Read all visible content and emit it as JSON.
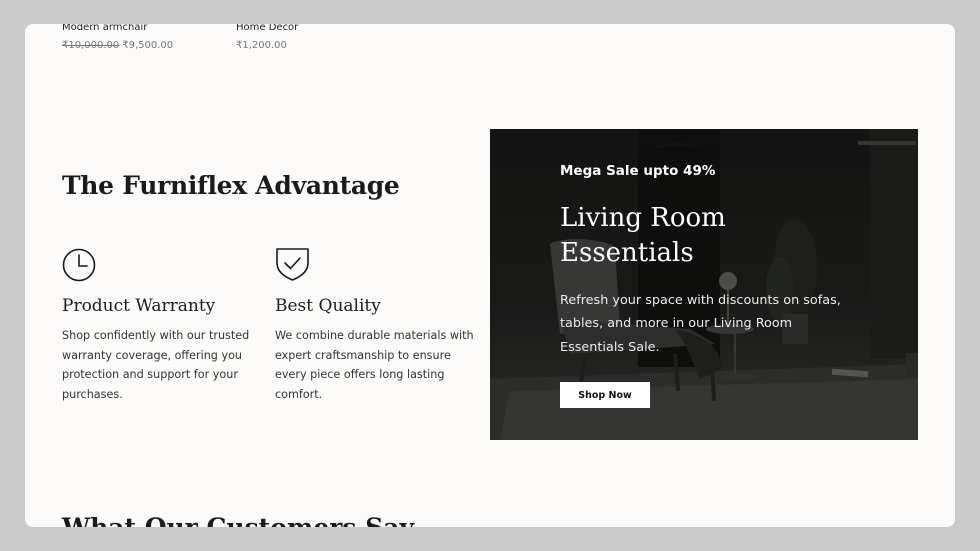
{
  "products": [
    {
      "name": "Modern armchair",
      "old_price": "₹10,000.00",
      "price": "₹9,500.00"
    },
    {
      "name": "Home Decor",
      "price": "₹1,200.00"
    }
  ],
  "advantage": {
    "title_pre": "The ",
    "title_bold": "Furniflex",
    "title_post": " Advantage",
    "features": [
      {
        "icon": "clock-icon",
        "title": "Product Warranty",
        "text": "Shop confidently with our trusted warranty coverage, offering you protection and support for your purchases."
      },
      {
        "icon": "shield-check-icon",
        "title": "Best Quality",
        "text": "We combine durable materials with expert craftsmanship to ensure every piece offers long lasting comfort."
      }
    ]
  },
  "banner": {
    "sale_label": "Mega Sale upto 49%",
    "title_line1": "Living Room",
    "title_line2": "Essentials",
    "description": "Refresh your space with discounts on sofas, tables, and more in our Living Room Essentials Sale.",
    "button_label": "Shop Now"
  },
  "next_section": {
    "title": "What Our Customers Say"
  }
}
